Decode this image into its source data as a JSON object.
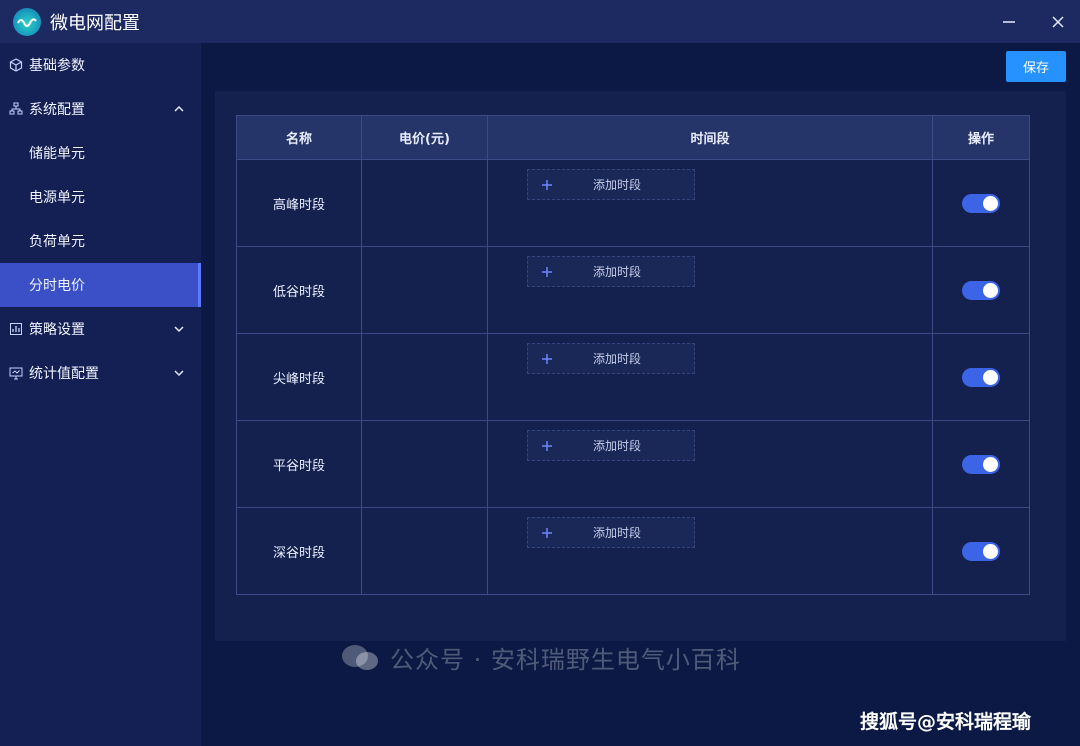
{
  "window": {
    "title": "微电网配置"
  },
  "sidebar": {
    "items": [
      {
        "label": "基础参数",
        "icon": "cube-icon",
        "type": "group"
      },
      {
        "label": "系统配置",
        "icon": "network-icon",
        "type": "group",
        "expanded": true,
        "children": [
          {
            "label": "储能单元"
          },
          {
            "label": "电源单元"
          },
          {
            "label": "负荷单元"
          },
          {
            "label": "分时电价",
            "active": true
          }
        ]
      },
      {
        "label": "策略设置",
        "icon": "chart-icon",
        "type": "group",
        "expanded": false
      },
      {
        "label": "统计值配置",
        "icon": "monitor-icon",
        "type": "group",
        "expanded": false
      }
    ]
  },
  "toolbar": {
    "save_label": "保存"
  },
  "table": {
    "headers": [
      "名称",
      "电价(元)",
      "时间段",
      "操作"
    ],
    "add_slot_label": "添加时段",
    "rows": [
      {
        "name": "高峰时段",
        "price": "",
        "enabled": true
      },
      {
        "name": "低谷时段",
        "price": "",
        "enabled": true
      },
      {
        "name": "尖峰时段",
        "price": "",
        "enabled": true
      },
      {
        "name": "平谷时段",
        "price": "",
        "enabled": true
      },
      {
        "name": "深谷时段",
        "price": "",
        "enabled": true
      }
    ]
  },
  "watermark": {
    "text": "公众号 · 安科瑞野生电气小百科",
    "corner": "搜狐号@安科瑞程瑜"
  },
  "colors": {
    "accent": "#2592ff",
    "active_nav": "#3b4fc7",
    "toggle_on": "#3c64e6",
    "background": "#0c1944"
  }
}
